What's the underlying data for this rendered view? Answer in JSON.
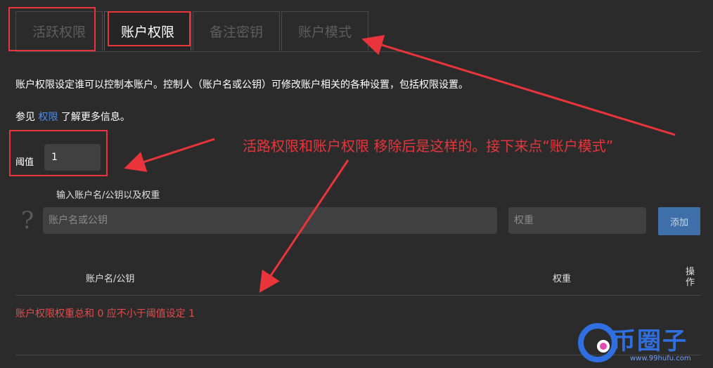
{
  "tabs": [
    {
      "label": "活跃权限",
      "active": false
    },
    {
      "label": "账户权限",
      "active": true
    },
    {
      "label": "备注密钥",
      "active": false
    },
    {
      "label": "账户模式",
      "active": false
    }
  ],
  "description": "账户权限设定谁可以控制本账户。控制人（账户名或公钥）可修改账户相关的各种设置，包括权限设置。",
  "see_more": {
    "prefix": "参见",
    "link": "权限",
    "suffix": "了解更多信息。"
  },
  "threshold": {
    "label": "阈值",
    "value": "1"
  },
  "input_section": {
    "title": "输入账户名/公钥以及权重",
    "help_icon": "?",
    "account_placeholder": "账户名或公钥",
    "weight_placeholder": "权重",
    "add_label": "添加"
  },
  "table": {
    "headers": {
      "account": "账户名/公钥",
      "weight": "权重",
      "ops": "操作"
    }
  },
  "error": "账户权限权重总和 0 应不小于阈值设定 1",
  "annotation": "活路权限和账户权限 移除后是这样的。接下来点“账户模式”",
  "watermark": {
    "text": "币圈子",
    "url": "www.99hufu.com"
  },
  "colors": {
    "background": "#2b2b2b",
    "accent": "#3e6fa8",
    "error": "#e24b4b",
    "annotation": "#e8343a"
  }
}
